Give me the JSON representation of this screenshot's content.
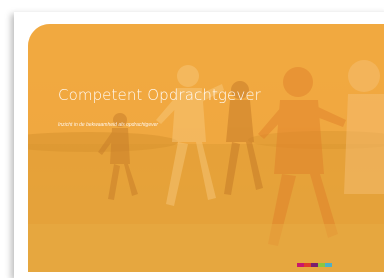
{
  "document": {
    "title": "Competent Opdrachtgever",
    "subtitle": "Inzicht in de bekwaamheid als opdrachtgever"
  },
  "cover_image": {
    "icon": "children-running-photo",
    "overlay_color": "#f0a53a"
  },
  "color_bar": {
    "colors": [
      "#c8176c",
      "#e03a2a",
      "#7a1e6e",
      "#8cc63f",
      "#4fb0c6"
    ]
  }
}
